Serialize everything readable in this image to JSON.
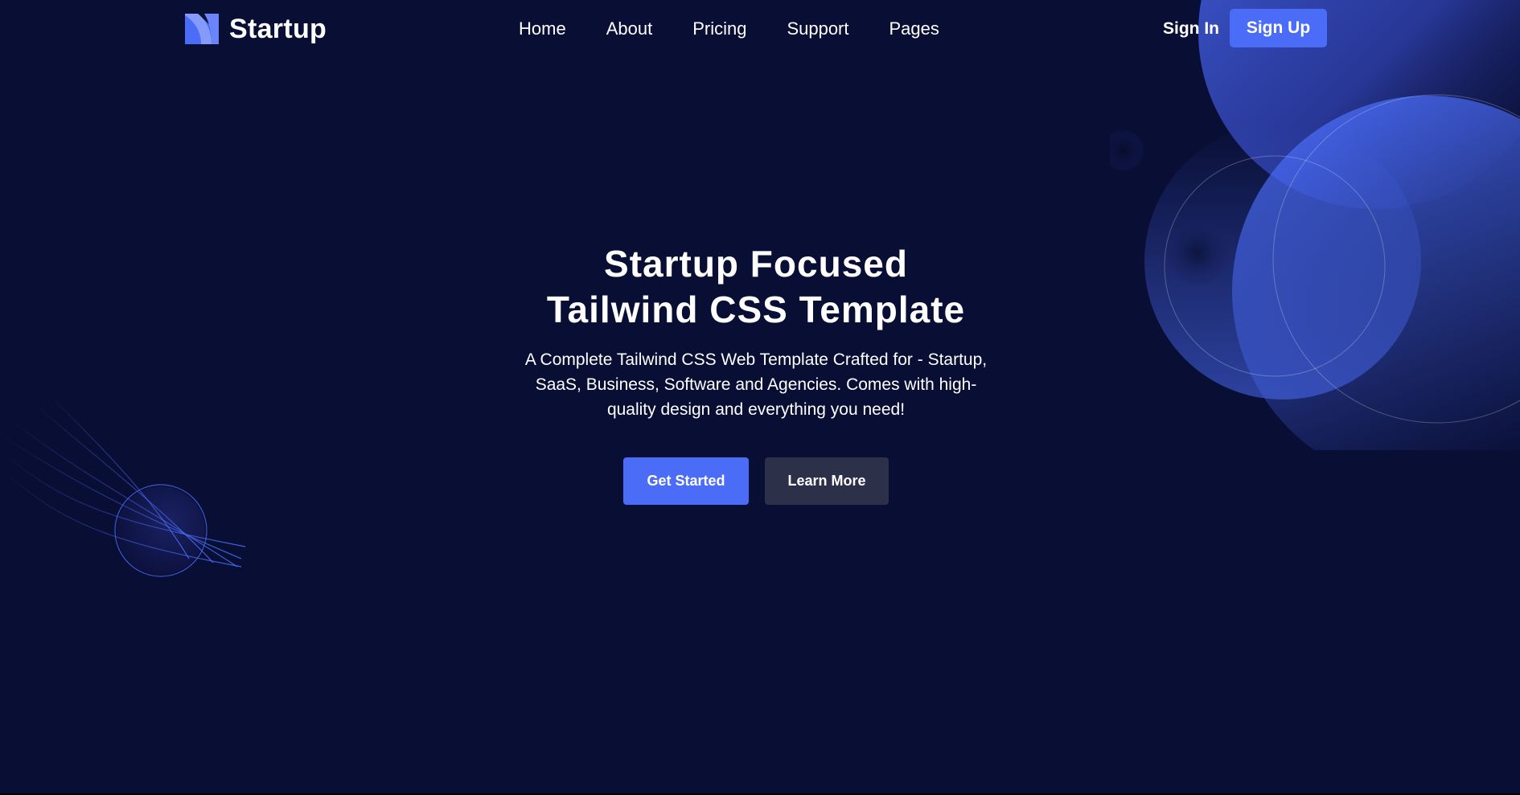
{
  "header": {
    "brand": "Startup",
    "nav": [
      {
        "label": "Home"
      },
      {
        "label": "About"
      },
      {
        "label": "Pricing"
      },
      {
        "label": "Support"
      },
      {
        "label": "Pages"
      }
    ],
    "sign_in": "Sign In",
    "sign_up": "Sign Up"
  },
  "hero": {
    "title_line1": "Startup Focused",
    "title_line2": "Tailwind CSS Template",
    "subtitle": "A Complete Tailwind CSS Web Template Crafted for - Startup, SaaS, Business, Software and Agencies. Comes with high-quality design and everything you need!",
    "primary_cta": "Get Started",
    "secondary_cta": "Learn More"
  },
  "colors": {
    "background": "#090e34",
    "accent": "#4a6cf7",
    "secondary_button": "#2c3048",
    "text": "#ffffff"
  },
  "icons": {
    "logo": "startup-logo-icon"
  }
}
